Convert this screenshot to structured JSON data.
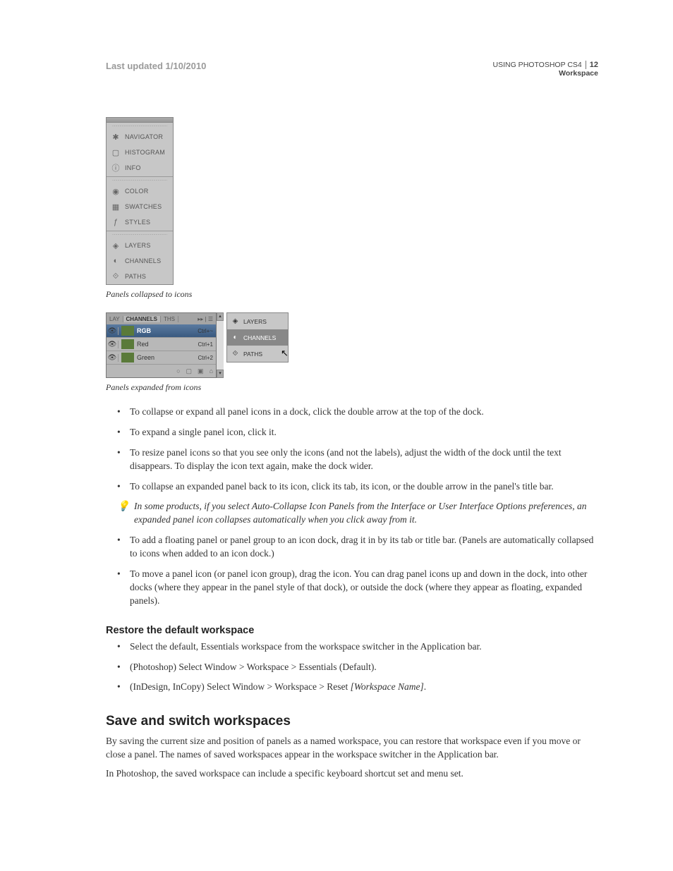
{
  "header": {
    "last_updated": "Last updated 1/10/2010",
    "doc_title": "USING PHOTOSHOP CS4",
    "section": "Workspace",
    "page_num": "12"
  },
  "fig1": {
    "items": [
      {
        "icon": "✱",
        "label": "NAVIGATOR"
      },
      {
        "icon": "▢",
        "label": "HISTOGRAM"
      },
      {
        "icon": "ⓘ",
        "label": "INFO"
      },
      {
        "icon": "◉",
        "label": "COLOR"
      },
      {
        "icon": "▦",
        "label": "SWATCHES"
      },
      {
        "icon": "ƒ",
        "label": "STYLES"
      },
      {
        "icon": "◈",
        "label": "LAYERS"
      },
      {
        "icon": "◐",
        "label": "CHANNELS"
      },
      {
        "icon": "⟐",
        "label": "PATHS"
      }
    ],
    "caption": "Panels collapsed to icons"
  },
  "fig2": {
    "tabs": {
      "left": "LAY",
      "mid": "CHANNELS",
      "right": "THS",
      "menu": "▸▸ | ☰"
    },
    "rows": [
      {
        "name": "RGB",
        "shortcut": "Ctrl+~",
        "selected": true
      },
      {
        "name": "Red",
        "shortcut": "Ctrl+1",
        "selected": false
      },
      {
        "name": "Green",
        "shortcut": "Ctrl+2",
        "selected": false
      }
    ],
    "footer_icons": [
      "○",
      "▢",
      "▣",
      "⌂"
    ],
    "side": [
      {
        "icon": "◈",
        "label": "LAYERS",
        "sel": false
      },
      {
        "icon": "◐",
        "label": "CHANNELS",
        "sel": true
      },
      {
        "icon": "⟐",
        "label": "PATHS",
        "sel": false
      }
    ],
    "caption": "Panels expanded from icons"
  },
  "list1": [
    "To collapse or expand all panel icons in a dock, click the double arrow at the top of the dock.",
    "To expand a single panel icon, click it.",
    "To resize panel icons so that you see only the icons (and not the labels), adjust the width of the dock until the text disappears. To display the icon text again, make the dock wider.",
    "To collapse an expanded panel back to its icon, click its tab, its icon, or the double arrow in the panel's title bar."
  ],
  "tip": "In some products, if you select Auto-Collapse Icon Panels from the Interface or User Interface Options preferences, an expanded panel icon collapses automatically when you click away from it.",
  "list2": [
    "To add a floating panel or panel group to an icon dock, drag it in by its tab or title bar. (Panels are automatically collapsed to icons when added to an icon dock.)",
    "To move a panel icon (or panel icon group), drag the icon. You can drag panel icons up and down in the dock, into other docks (where they appear in the panel style of that dock), or outside the dock (where they appear as floating, expanded panels)."
  ],
  "restore": {
    "heading": "Restore the default workspace",
    "items": [
      {
        "text": "Select the default, Essentials workspace from the workspace switcher in the Application bar."
      },
      {
        "text": "(Photoshop) Select Window > Workspace > Essentials (Default)."
      },
      {
        "prefix": "(InDesign, InCopy) Select Window > Workspace > Reset ",
        "ital": "[Workspace Name]",
        "suffix": "."
      }
    ]
  },
  "save": {
    "heading": "Save and switch workspaces",
    "p1": "By saving the current size and position of panels as a named workspace, you can restore that workspace even if you move or close a panel. The names of saved workspaces appear in the workspace switcher in the Application bar.",
    "p2": "In Photoshop, the saved workspace can include a specific keyboard shortcut set and menu set."
  }
}
